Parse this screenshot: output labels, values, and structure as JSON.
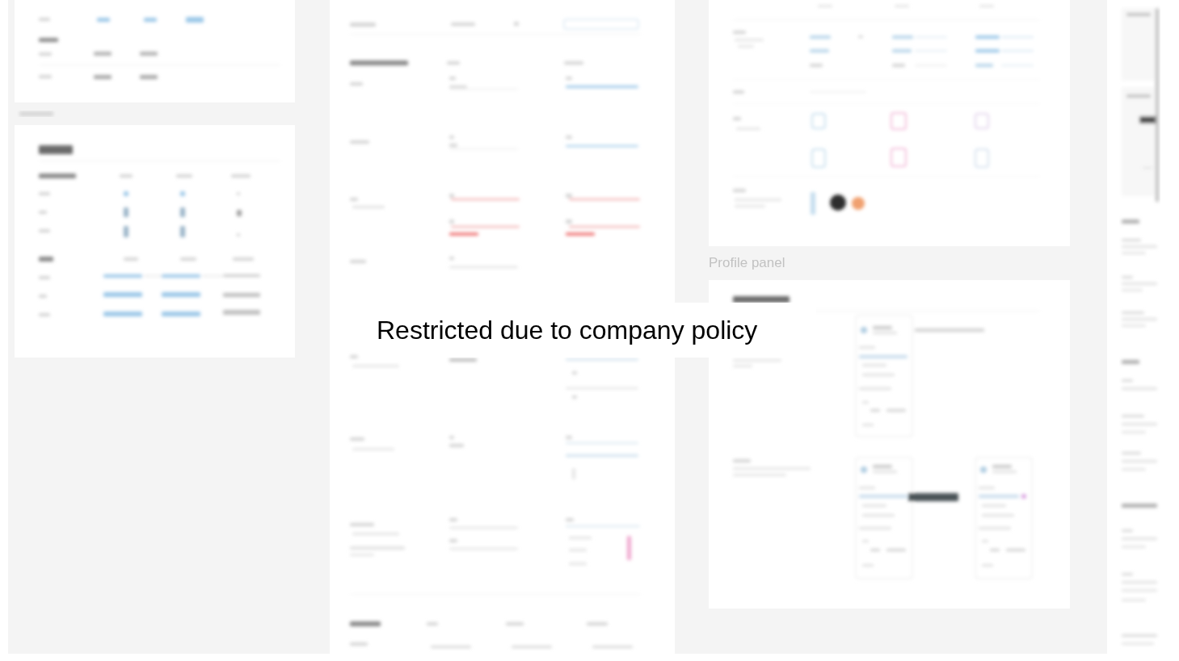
{
  "canvas": {
    "section_label": "Profile panel"
  },
  "notice": {
    "message": "Restricted due to company policy"
  }
}
